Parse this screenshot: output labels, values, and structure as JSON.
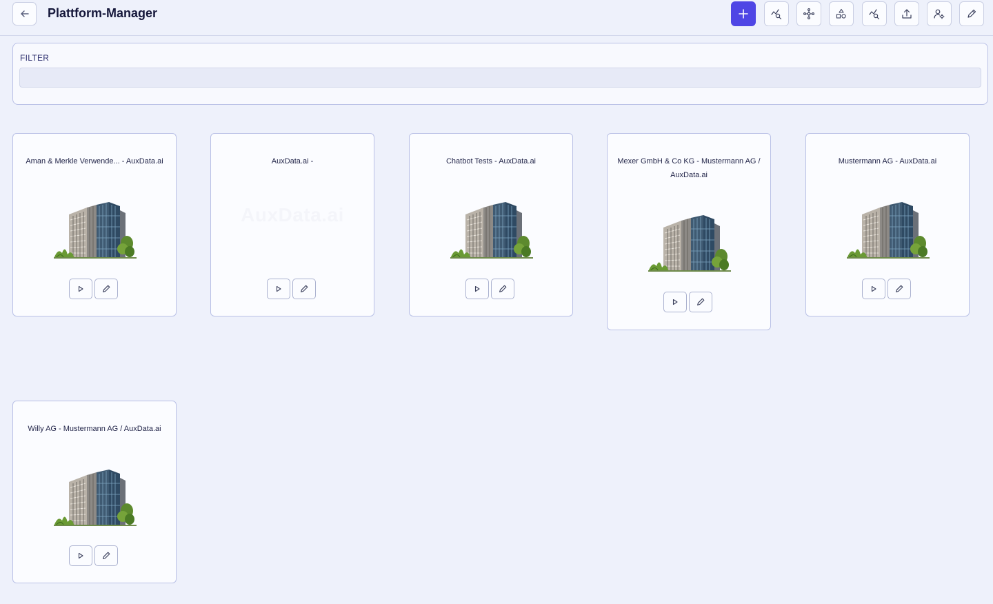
{
  "header": {
    "title": "Plattform-Manager",
    "back_icon": "arrow-left-icon",
    "toolbar": [
      {
        "name": "add",
        "icon": "plus-icon"
      },
      {
        "name": "chart-search",
        "icon": "chart-search-icon"
      },
      {
        "name": "network",
        "icon": "network-icon"
      },
      {
        "name": "shapes",
        "icon": "shapes-icon"
      },
      {
        "name": "chart-search-2",
        "icon": "chart-search-icon"
      },
      {
        "name": "upload",
        "icon": "upload-icon"
      },
      {
        "name": "user-settings",
        "icon": "user-settings-icon"
      },
      {
        "name": "edit",
        "icon": "pencil-icon"
      }
    ]
  },
  "filter": {
    "label": "FILTER",
    "value": "",
    "placeholder": ""
  },
  "cards": [
    {
      "title": "Aman & Merkle Verwende... - AuxData.ai",
      "has_image": true
    },
    {
      "title": "AuxData.ai -",
      "has_image": false,
      "placeholder_logo": "AuxData.ai"
    },
    {
      "title": "Chatbot Tests - AuxData.ai",
      "has_image": true
    },
    {
      "title": "Mexer GmbH & Co KG - Mustermann AG / AuxData.ai",
      "has_image": true
    },
    {
      "title": "Mustermann AG - AuxData.ai",
      "has_image": true
    },
    {
      "title": "Willy AG - Mustermann AG / AuxData.ai",
      "has_image": true
    }
  ],
  "card_actions": {
    "play_icon": "play-icon",
    "edit_icon": "pencil-icon"
  },
  "colors": {
    "background": "#eef1fb",
    "primary": "#4f46e5",
    "border": "#b9c0e6",
    "card_bg": "#fbfcff"
  }
}
